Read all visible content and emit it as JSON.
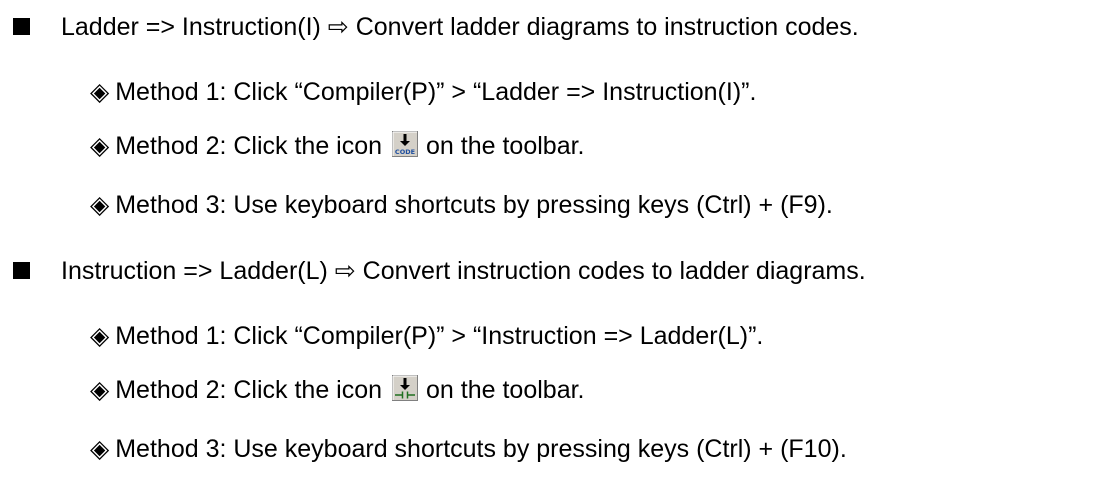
{
  "sections": [
    {
      "heading_prefix": "Ladder => Instruction(I) ⇨ ",
      "heading_text": "Convert ladder diagrams to instruction codes.",
      "items": [
        {
          "text": "Method 1: Click “Compiler(P)” > “Ladder => Instruction(I)”."
        },
        {
          "text_before": "Method 2: Click the icon",
          "icon": "code-convert-icon",
          "text_after": "on the toolbar."
        },
        {
          "text": "Method 3: Use keyboard shortcuts by pressing keys (Ctrl) + (F9)."
        }
      ]
    },
    {
      "heading_prefix": "Instruction => Ladder(L) ⇨ ",
      "heading_text": "Convert instruction codes to ladder diagrams.",
      "items": [
        {
          "text": "Method 1: Click “Compiler(P)” > “Instruction => Ladder(L)”."
        },
        {
          "text_before": "Method 2: Click the icon",
          "icon": "ladder-convert-icon",
          "text_after": "on the toolbar."
        },
        {
          "text": "Method 3: Use keyboard shortcuts by pressing keys (Ctrl) + (F10)."
        }
      ]
    }
  ],
  "symbols": {
    "diamond": "◈"
  }
}
